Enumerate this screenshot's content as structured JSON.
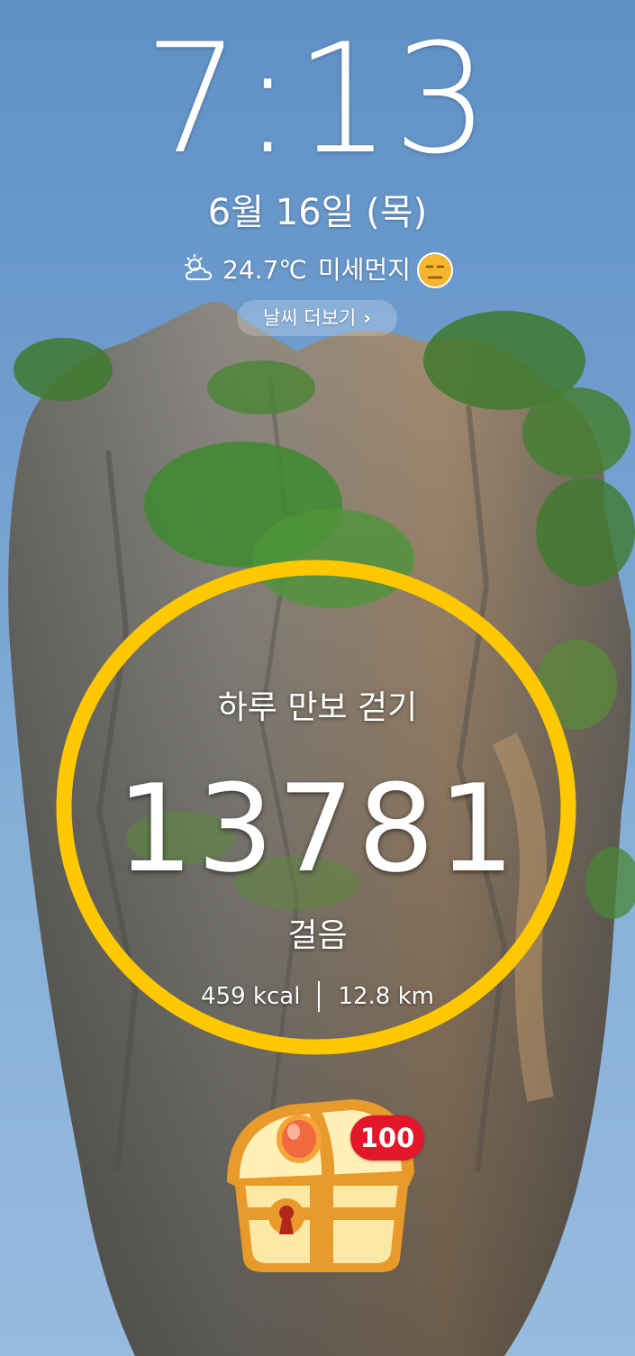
{
  "lockscreen": {
    "time": "7:13",
    "date": "6월 16일 (목)",
    "weather": {
      "icon": "partly-cloudy-icon",
      "temperature": "24.7℃",
      "dust_label": "미세먼지",
      "dust_icon": "frown-face-icon",
      "more_label": "날씨 더보기"
    }
  },
  "step_widget": {
    "title": "하루 만보 걷기",
    "steps": "13781",
    "unit": "걸음",
    "calories": "459 kcal",
    "distance": "12.8 km",
    "ring_color": "#ffc800"
  },
  "reward": {
    "icon": "treasure-chest-icon",
    "badge": "100",
    "badge_color": "#e4162a"
  }
}
